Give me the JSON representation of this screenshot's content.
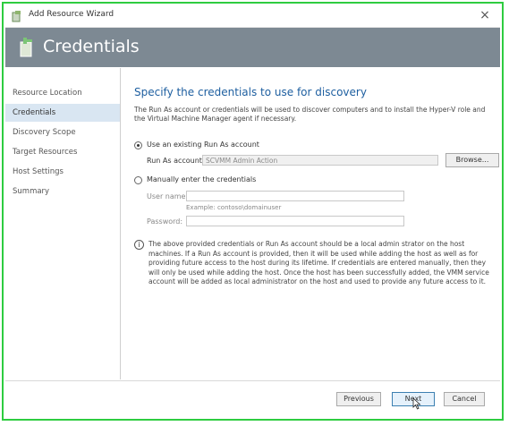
{
  "window": {
    "title": "Add Resource Wizard",
    "close_glyph": "×"
  },
  "banner": {
    "title": "Credentials"
  },
  "sidebar": {
    "items": [
      {
        "label": "Resource Location",
        "active": false
      },
      {
        "label": "Credentials",
        "active": true
      },
      {
        "label": "Discovery Scope",
        "active": false
      },
      {
        "label": "Target Resources",
        "active": false
      },
      {
        "label": "Host Settings",
        "active": false
      },
      {
        "label": "Summary",
        "active": false
      }
    ]
  },
  "main": {
    "heading": "Specify the credentials to use for discovery",
    "description": "The Run As account or credentials will be used to discover computers and to install the Hyper-V role and the Virtual Machine Manager agent if necessary.",
    "option_existing": {
      "label": "Use an existing Run As account",
      "checked": true
    },
    "run_as_label": "Run As account:",
    "run_as_value": "SCVMM Admin Action",
    "browse_label": "Browse...",
    "option_manual": {
      "label": "Manually enter the credentials",
      "checked": false
    },
    "user_name_label": "User name:",
    "user_name_value": "",
    "user_name_hint": "Example: contoso\\domainuser",
    "password_label": "Password:",
    "password_value": "",
    "info_icon": "i",
    "info_text_1": "The above provided credentials or Run As account should be a local admin strator on the host",
    "info_text_2": "machines. If a Run As account is provided, then it will be used while adding the host as well as for",
    "info_text_3": "providing future access to the host during its lifetime. If credentials are entered manually, then they",
    "info_text_4": "will only be used while adding the host. Once the host has been successfully added, the VMM service",
    "info_text_5": "account will be added as local administrator on the host and used to provide any future access to it."
  },
  "footer": {
    "previous_label": "Previous",
    "next_label": "Next",
    "cancel_label": "Cancel"
  },
  "colors": {
    "banner_bg": "#7d8993",
    "heading": "#1e5fa0",
    "frame_border": "#2ecc40",
    "active_item_bg": "#d9e6f2"
  }
}
